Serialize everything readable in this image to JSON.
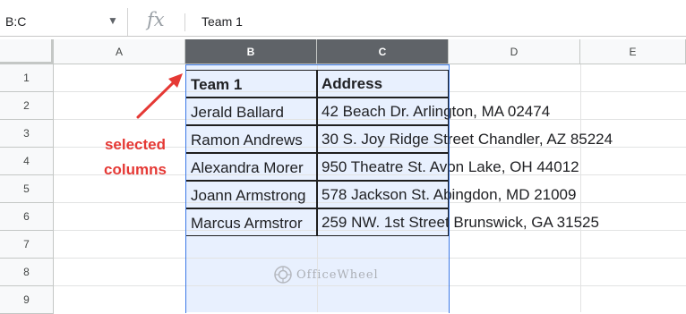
{
  "formula_bar": {
    "name_box": "B:C",
    "fx_label": "fx",
    "value": "Team 1"
  },
  "columns": [
    "A",
    "B",
    "C",
    "D",
    "E"
  ],
  "rows": [
    "1",
    "2",
    "3",
    "4",
    "5",
    "6",
    "7",
    "8",
    "9"
  ],
  "table": {
    "headers": [
      "Team 1",
      "Address"
    ],
    "names": [
      "Jerald Ballard",
      "Ramon Andrews",
      "Alexandra Morer",
      "Joann Armstrong",
      "Marcus Armstror"
    ],
    "addresses": [
      "42 Beach Dr. Arlington, MA 02474",
      "30 S. Joy Ridge Street Chandler, AZ 85224",
      "950 Theatre St. Avon Lake, OH 44012",
      "578 Jackson St. Abingdon, MD 21009",
      "259 NW. 1st Street Brunswick, GA 31525"
    ]
  },
  "annotation": {
    "line1": "selected",
    "line2": "columns",
    "color": "#e53935"
  },
  "watermark": "OfficeWheel",
  "colors": {
    "selection_fill": "#e8f0fe",
    "selection_border": "#3b78e7",
    "selected_header": "#5f6368"
  }
}
